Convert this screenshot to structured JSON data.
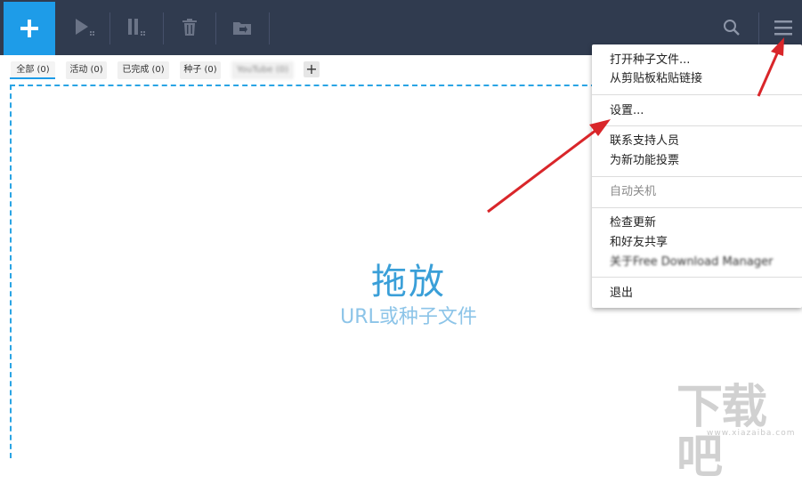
{
  "toolbar": {
    "add_button_icon": "plus-icon",
    "buttons": [
      "play-icon",
      "pause-icon",
      "trash-icon",
      "move-icon"
    ],
    "search_icon": "search-icon",
    "menu_icon": "hamburger-menu-icon",
    "colors": {
      "toolbar_bg": "#303b4f",
      "accent": "#1e9ce8"
    }
  },
  "tabs": [
    {
      "label": "全部 (0)",
      "active": true
    },
    {
      "label": "活动 (0)"
    },
    {
      "label": "已完成 (0)"
    },
    {
      "label": "种子 (0)"
    },
    {
      "label": "YouTube (0)"
    }
  ],
  "add_tab_label": "+",
  "drop": {
    "title": "拖放",
    "subtitle": "URL或种子文件"
  },
  "menu": {
    "items": [
      "打开种子文件...",
      "从剪贴板粘贴链接",
      "设置...",
      "联系支持人员",
      "为新功能投票",
      "自动关机",
      "检查更新",
      "和好友共享",
      "关于Free Download Manager",
      "退出"
    ]
  },
  "watermark": {
    "text": "下载吧",
    "url": "www.xiazaiba.com"
  }
}
